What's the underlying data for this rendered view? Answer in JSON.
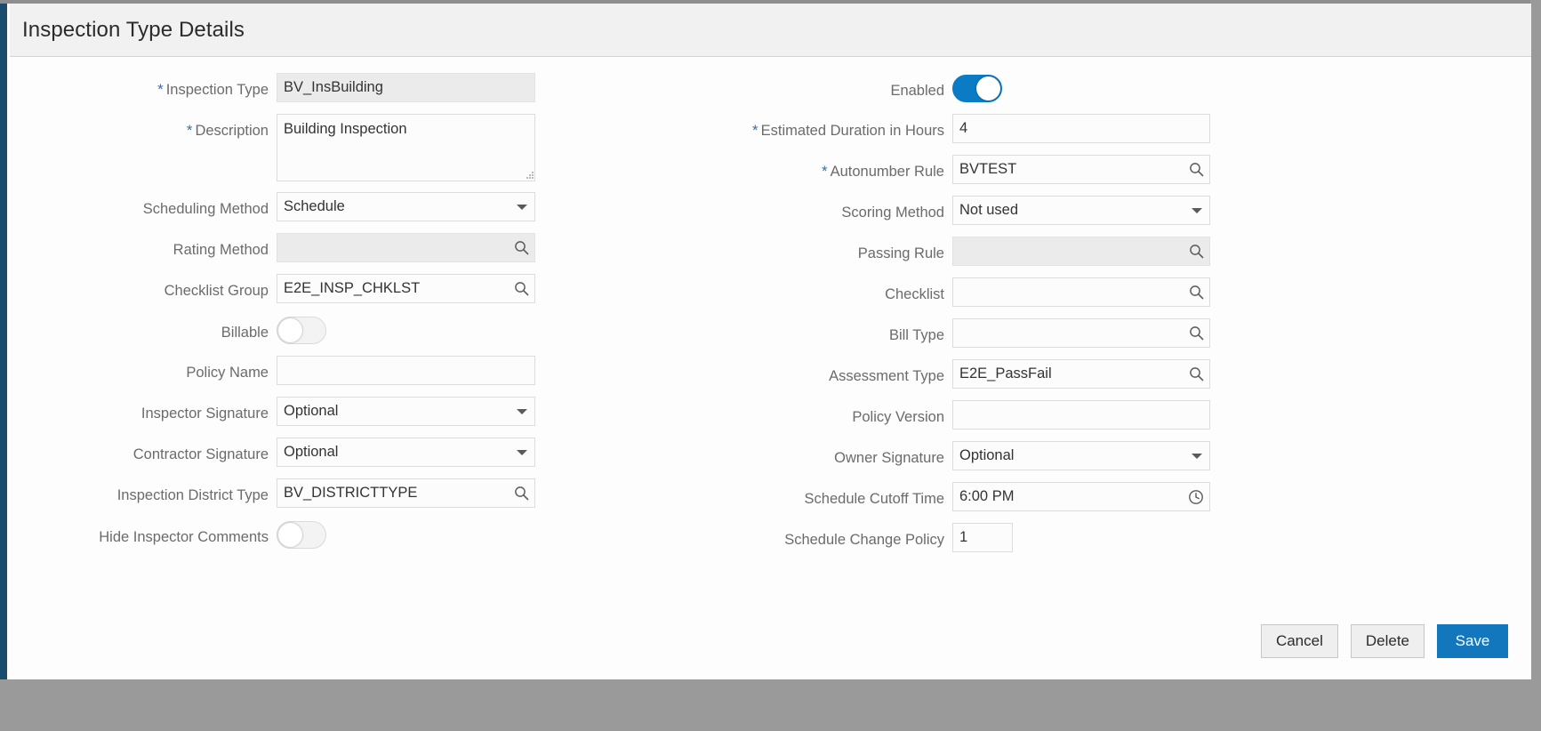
{
  "dialog": {
    "title": "Inspection Type Details"
  },
  "left_fields": [
    {
      "label": "Inspection Type",
      "required": true,
      "control": "text",
      "value": "BV_InsBuilding",
      "readonly": true,
      "icon": ""
    },
    {
      "label": "Description",
      "required": true,
      "control": "textarea",
      "value": "Building Inspection",
      "readonly": false,
      "icon": "resize-grip-icon"
    },
    {
      "label": "Scheduling Method",
      "required": false,
      "control": "select",
      "value": "Schedule",
      "readonly": false,
      "icon": "chevron-down-icon"
    },
    {
      "label": "Rating Method",
      "required": false,
      "control": "lookup",
      "value": "",
      "readonly": true,
      "icon": "search-icon"
    },
    {
      "label": "Checklist Group",
      "required": false,
      "control": "lookup",
      "value": "E2E_INSP_CHKLST",
      "readonly": false,
      "icon": "search-icon"
    },
    {
      "label": "Billable",
      "required": false,
      "control": "toggle",
      "value": "off",
      "readonly": false,
      "icon": "toggle-icon"
    },
    {
      "label": "Policy Name",
      "required": false,
      "control": "text",
      "value": "",
      "readonly": false,
      "icon": ""
    },
    {
      "label": "Inspector Signature",
      "required": false,
      "control": "select",
      "value": "Optional",
      "readonly": false,
      "icon": "chevron-down-icon"
    },
    {
      "label": "Contractor Signature",
      "required": false,
      "control": "select",
      "value": "Optional",
      "readonly": false,
      "icon": "chevron-down-icon"
    },
    {
      "label": "Inspection District Type",
      "required": false,
      "control": "lookup",
      "value": "BV_DISTRICTTYPE",
      "readonly": false,
      "icon": "search-icon"
    },
    {
      "label": "Hide Inspector Comments",
      "required": false,
      "control": "toggle",
      "value": "off",
      "readonly": false,
      "icon": "toggle-icon"
    }
  ],
  "right_fields": [
    {
      "label": "Enabled",
      "required": false,
      "control": "toggle",
      "value": "on",
      "readonly": false,
      "icon": "toggle-icon"
    },
    {
      "label": "Estimated Duration in Hours",
      "required": true,
      "control": "text",
      "value": "4",
      "readonly": false,
      "icon": ""
    },
    {
      "label": "Autonumber Rule",
      "required": true,
      "control": "lookup",
      "value": "BVTEST",
      "readonly": false,
      "icon": "search-icon"
    },
    {
      "label": "Scoring Method",
      "required": false,
      "control": "select",
      "value": "Not used",
      "readonly": false,
      "icon": "chevron-down-icon"
    },
    {
      "label": "Passing Rule",
      "required": false,
      "control": "lookup",
      "value": "",
      "readonly": true,
      "icon": "search-icon"
    },
    {
      "label": "Checklist",
      "required": false,
      "control": "lookup",
      "value": "",
      "readonly": false,
      "icon": "search-icon"
    },
    {
      "label": "Bill Type",
      "required": false,
      "control": "lookup",
      "value": "",
      "readonly": false,
      "icon": "search-icon"
    },
    {
      "label": "Assessment Type",
      "required": false,
      "control": "lookup",
      "value": "E2E_PassFail",
      "readonly": false,
      "icon": "search-icon"
    },
    {
      "label": "Policy Version",
      "required": false,
      "control": "text",
      "value": "",
      "readonly": false,
      "icon": ""
    },
    {
      "label": "Owner Signature",
      "required": false,
      "control": "select",
      "value": "Optional",
      "readonly": false,
      "icon": "chevron-down-icon"
    },
    {
      "label": "Schedule Cutoff Time",
      "required": false,
      "control": "time",
      "value": "6:00 PM",
      "readonly": false,
      "icon": "clock-icon"
    },
    {
      "label": "Schedule Change Policy",
      "required": false,
      "control": "number",
      "value": "1",
      "readonly": false,
      "icon": ""
    }
  ],
  "footer": {
    "cancel_label": "Cancel",
    "delete_label": "Delete",
    "save_label": "Save"
  },
  "colors": {
    "accent": "#1277bc",
    "toggle_on": "#0a7bc4",
    "required_star": "#3a6ea5",
    "header_bg": "#f1f1f1",
    "readonly_bg": "#ebebeb"
  }
}
